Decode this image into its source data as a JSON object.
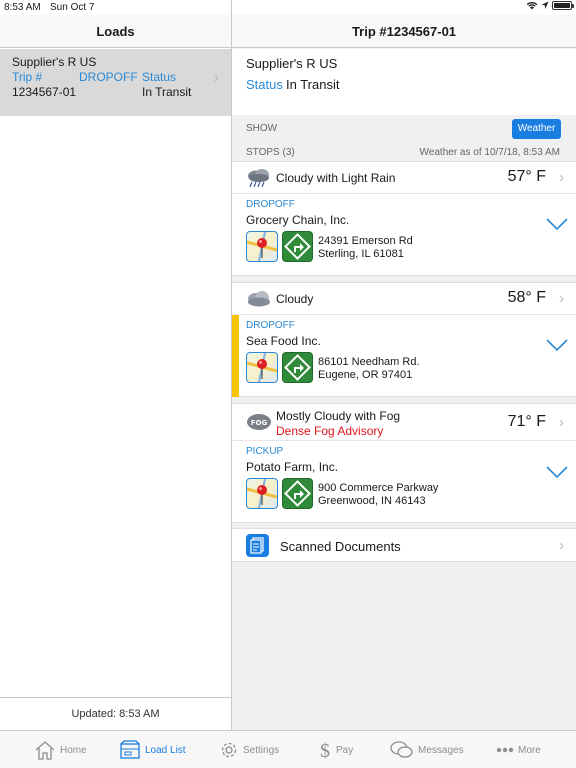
{
  "status_bar": {
    "time": "8:53 AM",
    "date": "Sun Oct 7"
  },
  "left_pane": {
    "title": "Loads",
    "load": {
      "supplier": "Supplier's R US",
      "col1_header": "Trip #",
      "col2_header": "DROPOFF",
      "col3_header": "Status",
      "trip_number": "1234567-01",
      "status": "In Transit"
    },
    "footer": "Updated: 8:53 AM"
  },
  "right_pane": {
    "title": "Trip #1234567-01",
    "supplier": "Supplier's R US",
    "status_label": "Status",
    "status_value": "In Transit",
    "show_label": "SHOW",
    "weather_button": "Weather",
    "stops_label": "STOPS (3)",
    "weather_asof": "Weather as of 10/7/18, 8:53 AM",
    "stops": [
      {
        "weather": "Cloudy with Light Rain",
        "advisory": "",
        "temp": "57° F",
        "type": "DROPOFF",
        "company": "Grocery Chain, Inc.",
        "addr1": "24391 Emerson Rd",
        "addr2": "Sterling, IL 61081",
        "icon": "rain-cloud-icon",
        "flagged": false
      },
      {
        "weather": "Cloudy",
        "advisory": "",
        "temp": "58° F",
        "type": "DROPOFF",
        "company": "Sea Food Inc.",
        "addr1": "86101 Needham Rd.",
        "addr2": "Eugene, OR 97401",
        "icon": "cloud-icon",
        "flagged": true
      },
      {
        "weather": "Mostly Cloudy with Fog",
        "advisory": "Dense Fog Advisory",
        "temp": "71° F",
        "type": "PICKUP",
        "company": "Potato Farm, Inc.",
        "addr1": "900 Commerce Parkway",
        "addr2": "Greenwood, IN 46143",
        "icon": "fog-icon",
        "flagged": false
      }
    ],
    "scanned_documents": "Scanned Documents"
  },
  "tabs": [
    {
      "label": "Home",
      "icon": "home-icon",
      "active": false
    },
    {
      "label": "Load List",
      "icon": "box-icon",
      "active": true
    },
    {
      "label": "Settings",
      "icon": "gear-icon",
      "active": false
    },
    {
      "label": "Pay",
      "icon": "dollar-icon",
      "active": false
    },
    {
      "label": "Messages",
      "icon": "chat-icon",
      "active": false
    },
    {
      "label": "More",
      "icon": "more-icon",
      "active": false
    }
  ],
  "colors": {
    "accent": "#1a7de0",
    "link": "#2a8ad6",
    "alert": "#e0151b",
    "flag": "#f4c400",
    "directions": "#2f8a3a"
  }
}
